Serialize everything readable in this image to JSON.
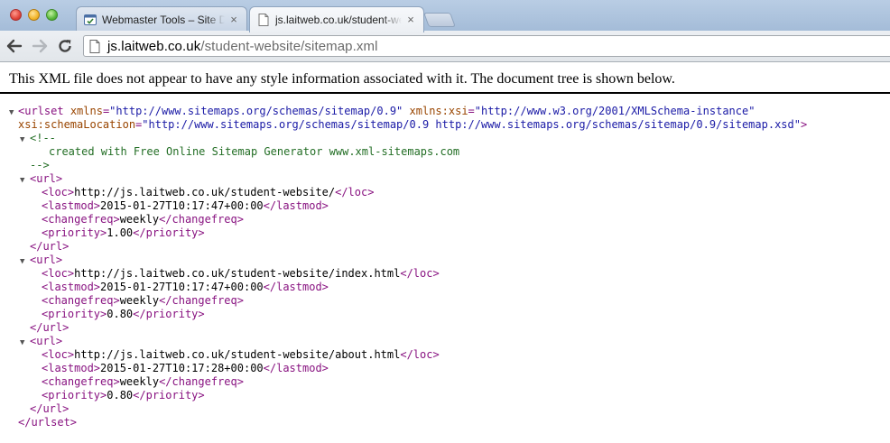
{
  "tabs": [
    {
      "title": "Webmaster Tools – Site Dashboard",
      "active": false,
      "icon": "webmaster-tools-favicon"
    },
    {
      "title": "js.laitweb.co.uk/student-website/sitemap.xml",
      "active": true,
      "icon": "page-icon"
    }
  ],
  "address": {
    "host": "js.laitweb.co.uk",
    "path": "/student-website/sitemap.xml"
  },
  "notice": "This XML file does not appear to have any style information associated with it. The document tree is shown below.",
  "xml": {
    "urlset_open": "<urlset",
    "xmlns_attr": "xmlns",
    "xmlns_val": "\"http://www.sitemaps.org/schemas/sitemap/0.9\"",
    "xsi_attr": "xmlns:xsi",
    "xsi_val": "\"http://www.w3.org/2001/XMLSchema-instance\"",
    "schema_attr": "xsi:schemaLocation",
    "schema_val": "\"http://www.sitemaps.org/schemas/sitemap/0.9 http://www.sitemaps.org/schemas/sitemap/0.9/sitemap.xsd\"",
    "comment_open": "<!--",
    "comment_text": "created with Free Online Sitemap Generator www.xml-sitemaps.com",
    "comment_close": "-->",
    "urlset_close": "</urlset>",
    "urls": [
      {
        "loc": "http://js.laitweb.co.uk/student-website/",
        "lastmod": "2015-01-27T10:17:47+00:00",
        "changefreq": "weekly",
        "priority": "1.00"
      },
      {
        "loc": "http://js.laitweb.co.uk/student-website/index.html",
        "lastmod": "2015-01-27T10:17:47+00:00",
        "changefreq": "weekly",
        "priority": "0.80"
      },
      {
        "loc": "http://js.laitweb.co.uk/student-website/about.html",
        "lastmod": "2015-01-27T10:17:28+00:00",
        "changefreq": "weekly",
        "priority": "0.80"
      }
    ]
  },
  "colors": {
    "tag": "#881280",
    "attr_name": "#994500",
    "attr_value": "#1a1aa6",
    "comment": "#236e25"
  }
}
